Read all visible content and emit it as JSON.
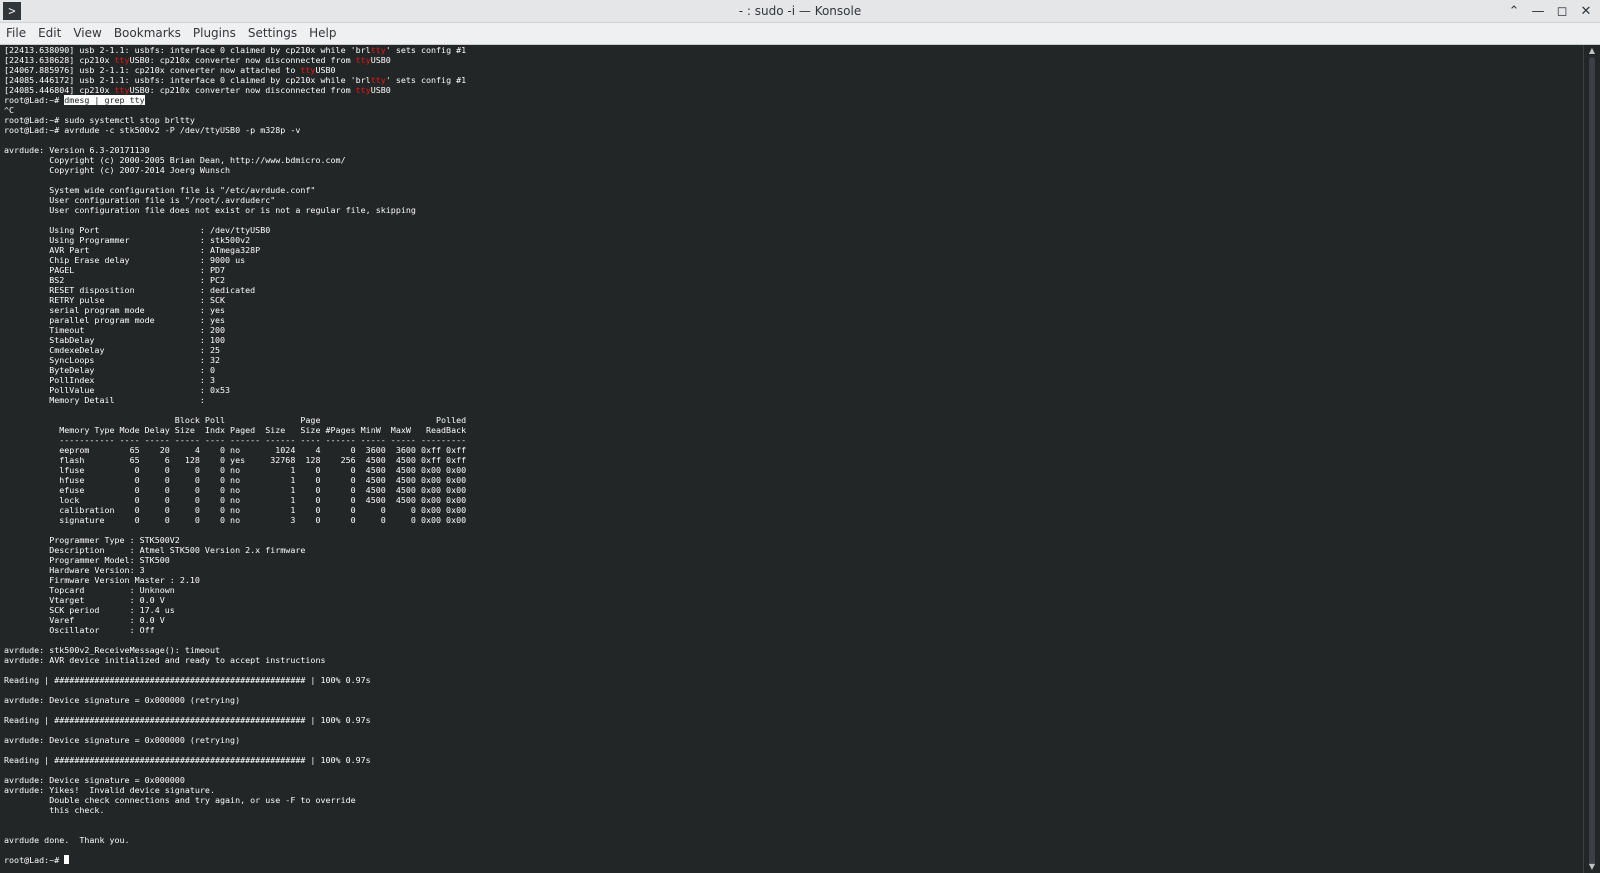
{
  "window": {
    "title": "- : sudo -i — Konsole",
    "app_icon_glyph": ">",
    "controls": {
      "keep_above": "⌃",
      "minimize": "—",
      "maximize": "◻",
      "close": "✕"
    }
  },
  "menubar": {
    "items": [
      "File",
      "Edit",
      "View",
      "Bookmarks",
      "Plugins",
      "Settings",
      "Help"
    ]
  },
  "terminal": {
    "highlight_word": "tty",
    "selected_command": "dmesg | grep tty",
    "prompt": "root@Lad:~# ",
    "lines": [
      "[22413.638090] usb 2-1.1: usbfs: interface 0 claimed by cp210x while 'brltty' sets config #1",
      "[22413.638628] cp210x ttyUSB0: cp210x converter now disconnected from ttyUSB0",
      "[24067.885976] usb 2-1.1: cp210x converter now attached to ttyUSB0",
      "[24085.446172] usb 2-1.1: usbfs: interface 0 claimed by cp210x while 'brltty' sets config #1",
      "[24085.446804] cp210x ttyUSB0: cp210x converter now disconnected from ttyUSB0",
      "root@Lad:~# dmesg | grep tty",
      "^C",
      "root@Lad:~# sudo systemctl stop brltty",
      "root@Lad:~# avrdude -c stk500v2 -P /dev/ttyUSB0 -p m328p -v",
      "",
      "avrdude: Version 6.3-20171130",
      "         Copyright (c) 2000-2005 Brian Dean, http://www.bdmicro.com/",
      "         Copyright (c) 2007-2014 Joerg Wunsch",
      "",
      "         System wide configuration file is \"/etc/avrdude.conf\"",
      "         User configuration file is \"/root/.avrduderc\"",
      "         User configuration file does not exist or is not a regular file, skipping",
      "",
      "         Using Port                    : /dev/ttyUSB0",
      "         Using Programmer              : stk500v2",
      "         AVR Part                      : ATmega328P",
      "         Chip Erase delay              : 9000 us",
      "         PAGEL                         : PD7",
      "         BS2                           : PC2",
      "         RESET disposition             : dedicated",
      "         RETRY pulse                   : SCK",
      "         serial program mode           : yes",
      "         parallel program mode         : yes",
      "         Timeout                       : 200",
      "         StabDelay                     : 100",
      "         CmdexeDelay                   : 25",
      "         SyncLoops                     : 32",
      "         ByteDelay                     : 0",
      "         PollIndex                     : 3",
      "         PollValue                     : 0x53",
      "         Memory Detail                 :",
      "",
      "                                  Block Poll               Page                       Polled",
      "           Memory Type Mode Delay Size  Indx Paged  Size   Size #Pages MinW  MaxW   ReadBack",
      "           ----------- ---- ----- ----- ---- ------ ------ ---- ------ ----- ----- ---------",
      "           eeprom        65    20     4    0 no       1024    4      0  3600  3600 0xff 0xff",
      "           flash         65     6   128    0 yes     32768  128    256  4500  4500 0xff 0xff",
      "           lfuse          0     0     0    0 no          1    0      0  4500  4500 0x00 0x00",
      "           hfuse          0     0     0    0 no          1    0      0  4500  4500 0x00 0x00",
      "           efuse          0     0     0    0 no          1    0      0  4500  4500 0x00 0x00",
      "           lock           0     0     0    0 no          1    0      0  4500  4500 0x00 0x00",
      "           calibration    0     0     0    0 no          1    0      0     0     0 0x00 0x00",
      "           signature      0     0     0    0 no          3    0      0     0     0 0x00 0x00",
      "",
      "         Programmer Type : STK500V2",
      "         Description     : Atmel STK500 Version 2.x firmware",
      "         Programmer Model: STK500",
      "         Hardware Version: 3",
      "         Firmware Version Master : 2.10",
      "         Topcard         : Unknown",
      "         Vtarget         : 0.0 V",
      "         SCK period      : 17.4 us",
      "         Varef           : 0.0 V",
      "         Oscillator      : Off",
      "",
      "avrdude: stk500v2_ReceiveMessage(): timeout",
      "avrdude: AVR device initialized and ready to accept instructions",
      "",
      "Reading | ################################################## | 100% 0.97s",
      "",
      "avrdude: Device signature = 0x000000 (retrying)",
      "",
      "Reading | ################################################## | 100% 0.97s",
      "",
      "avrdude: Device signature = 0x000000 (retrying)",
      "",
      "Reading | ################################################## | 100% 0.97s",
      "",
      "avrdude: Device signature = 0x000000",
      "avrdude: Yikes!  Invalid device signature.",
      "         Double check connections and try again, or use -F to override",
      "         this check.",
      "",
      "",
      "avrdude done.  Thank you.",
      "",
      "root@Lad:~# "
    ]
  }
}
